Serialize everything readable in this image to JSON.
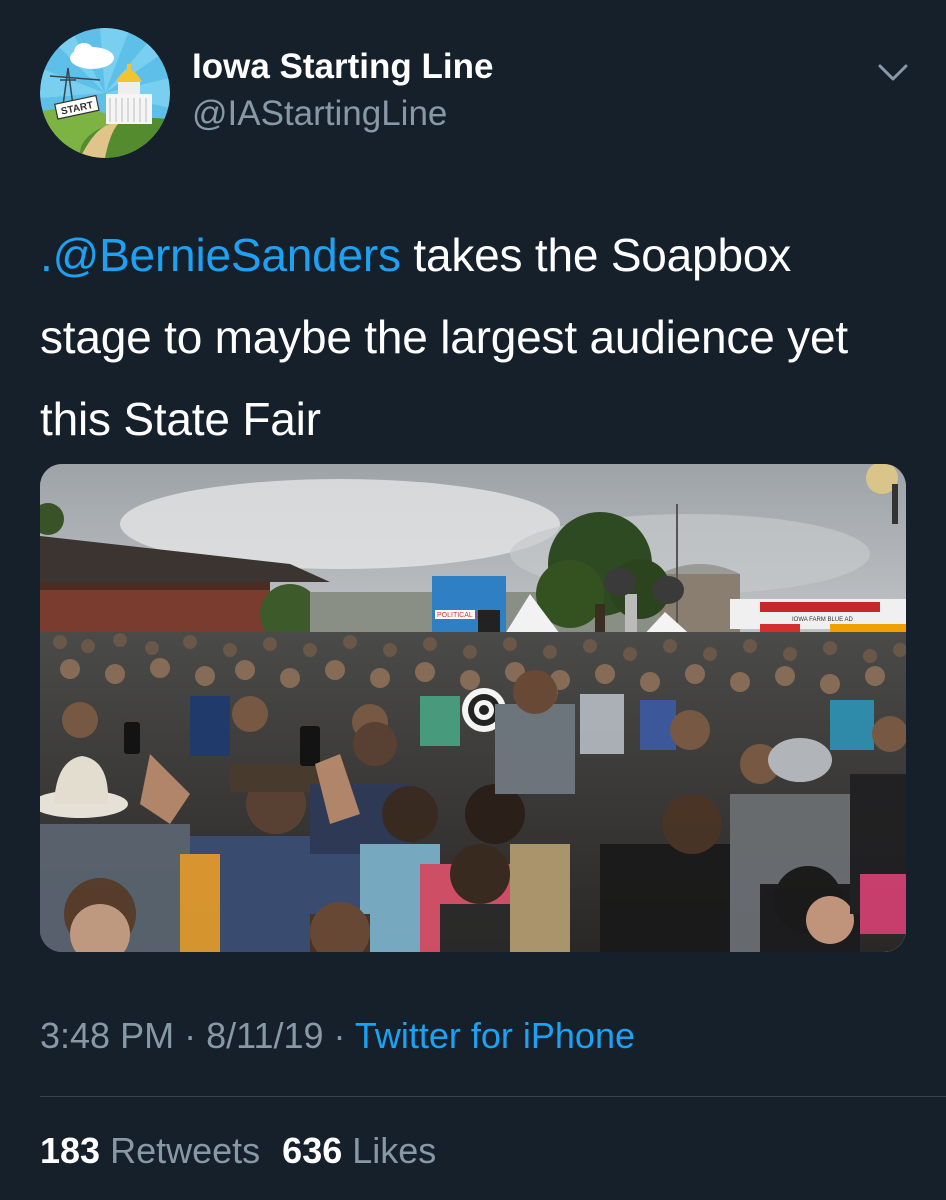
{
  "author": {
    "display_name": "Iowa Starting Line",
    "handle": "@IAStartingLine",
    "avatar_icon": "capitol-logo-icon",
    "avatar_badge": "START"
  },
  "menu_icon": "chevron-down-icon",
  "tweet": {
    "mention": ".@BernieSanders",
    "text": " takes the Soapbox stage to maybe the largest audience yet this State Fair"
  },
  "media": {
    "description_icon": "photo",
    "sign_text": "POLITICAL SO",
    "banner_text": "IOWA FARM BLUE AD"
  },
  "meta": {
    "time": "3:48 PM",
    "separator1": " · ",
    "date": "8/11/19",
    "separator2": " · ",
    "source": "Twitter for iPhone"
  },
  "stats": {
    "retweets_count": "183",
    "retweets_label": "Retweets",
    "likes_count": "636",
    "likes_label": "Likes"
  },
  "colors": {
    "background": "#15202b",
    "link": "#1da1f2",
    "secondary_text": "#8899a6"
  }
}
